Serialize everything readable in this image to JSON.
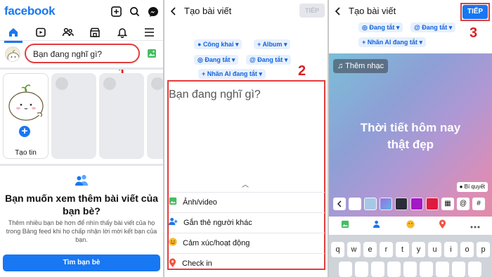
{
  "p1": {
    "logo": "facebook",
    "placeholder": "Bạn đang nghĩ gì?",
    "step": "1",
    "story_label": "Tạo tin",
    "heading": "Bạn muốn xem thêm bài viết của bạn bè?",
    "description": "Thêm nhiều bạn bè hơn để nhìn thấy bài viết của họ trong Bảng feed khi họ chấp nhận lời mời kết bạn của bạn.",
    "button": "Tìm bạn bè",
    "icons": [
      "plus-square-icon",
      "search-icon",
      "messenger-icon",
      "home-icon",
      "video-icon",
      "friends-icon",
      "marketplace-icon",
      "bell-icon",
      "menu-icon",
      "photo-icon",
      "add-icon",
      "friends-icon"
    ]
  },
  "p2": {
    "title": "Tạo bài viết",
    "next": "TIẾP",
    "chips": {
      "public": "Công khai",
      "album": "Album",
      "off1": "Đang tắt",
      "off2": "Đang tắt",
      "ai": "Nhãn AI đang tắt"
    },
    "placeholder": "Bạn đang nghĩ gì?",
    "step": "2",
    "options": [
      "Ảnh/video",
      "Gắn thẻ người khác",
      "Cảm xúc/hoạt động",
      "Check in"
    ]
  },
  "p3": {
    "title": "Tạo bài viết",
    "next": "TIẾP",
    "step": "3",
    "chips": {
      "off1": "Đang tắt",
      "off2": "Đang tắt",
      "ai": "Nhãn AI đang tắt"
    },
    "music": "Thêm nhạc",
    "text_line1": "Thời tiết hôm nay",
    "text_line2": "thật đẹp",
    "tips": "Bí quyết",
    "keys_row1": [
      "q",
      "w",
      "e",
      "r",
      "t",
      "y",
      "u",
      "i",
      "o",
      "p"
    ],
    "tool_keys": [
      "@",
      "#"
    ],
    "swatch_colors": [
      "#ffffff",
      "#a6c8e6",
      "#9c6ee0",
      "#2c2c3a",
      "#a319c4",
      "#e0193f"
    ]
  },
  "colors": {
    "brand": "#1877f2",
    "highlight": "#e23d3d"
  }
}
